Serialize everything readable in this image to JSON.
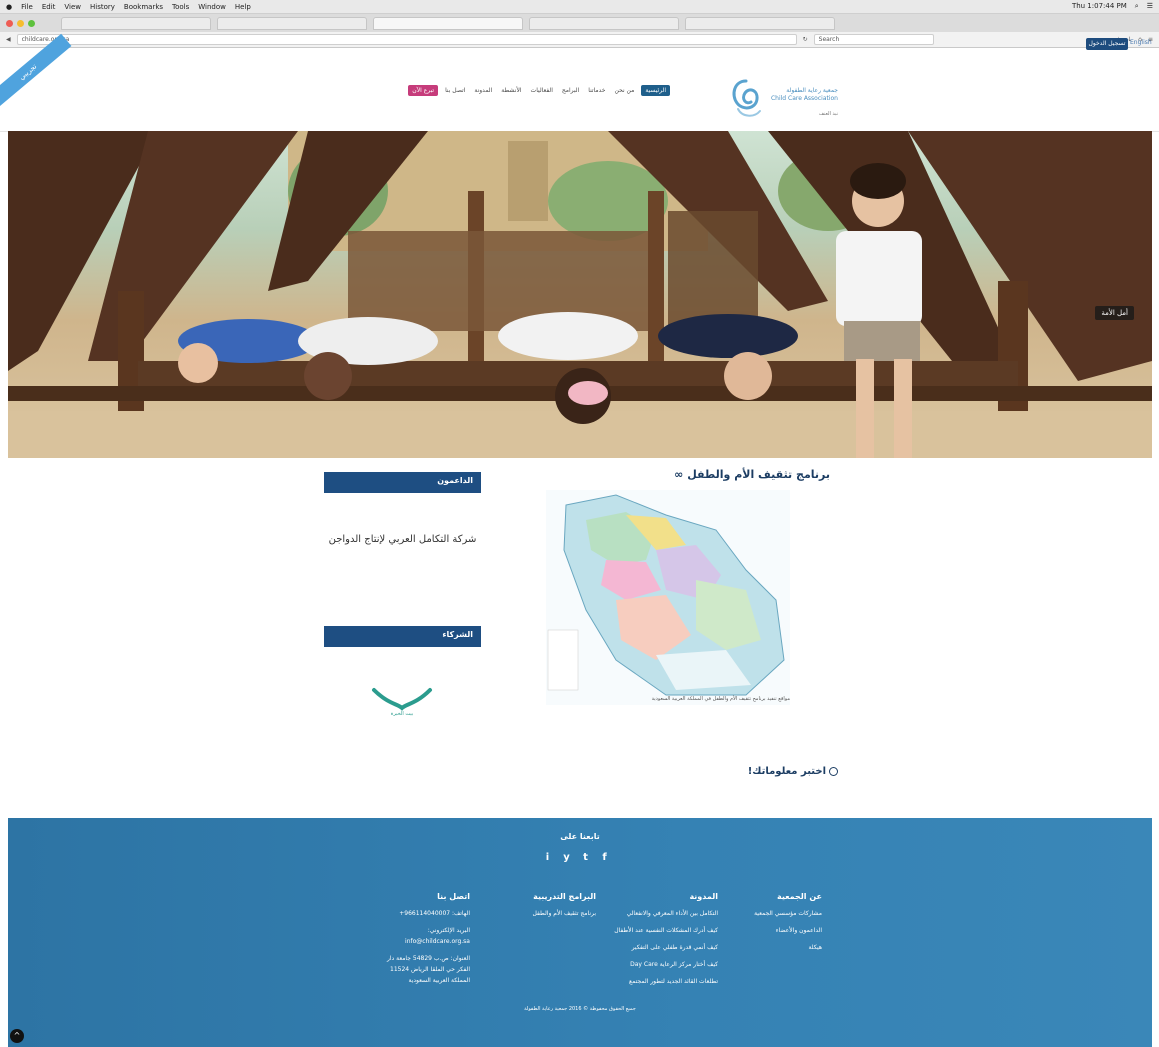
{
  "os_menu": {
    "items": [
      "File",
      "Edit",
      "View",
      "History",
      "Bookmarks",
      "Tools",
      "Window",
      "Help"
    ],
    "clock": "Thu 1:07:44 PM"
  },
  "browser": {
    "url": "childcare.org.sa",
    "search_placeholder": "Search"
  },
  "header": {
    "ribbon": "تجريبي",
    "login": "تسجيل الدخول",
    "lang": "English",
    "logo_name": "جمعية رعاية الطفولة",
    "logo_en": "Child Care Association",
    "logo_sub": "نبذ العنف",
    "nav": [
      "الرئيسية",
      "من نحن",
      "خدماتنا",
      "البرامج",
      "الفعاليات",
      "الأنشطة",
      "المدونة",
      "اتصل بنا",
      "تبرع الآن"
    ]
  },
  "hero": {
    "caption": "أمل الأمة"
  },
  "main": {
    "title": "برنامج تثقيف الأم والطفل",
    "map_caption": "مواقع تنفيذ برنامج تثقيف الأم والطفل في المملكة العربية السعودية",
    "quiz": "اختبر معلوماتك!"
  },
  "sidebar": {
    "supporters_title": "الداعمون",
    "supporter": "شركة التكامل العربي لإنتاج الدواجن",
    "partners_title": "الشركاء",
    "partner_name": "بيت الخبرة"
  },
  "footer": {
    "follow": "تابعنا على",
    "socials": [
      "f",
      "t",
      "y",
      "i"
    ],
    "col1": {
      "title": "عن الجمعية",
      "links": [
        "مشاركات مؤسسي الجمعية",
        "الداعمون والأعضاء",
        "هيكلة"
      ]
    },
    "col2": {
      "title": "المدونة",
      "links": [
        "التكامل بين الأداء المعرفي والانفعالي",
        "كيف أدرك المشكلات النفسية عند الأطفال",
        "كيف أنمي قدرة طفلي على التفكير",
        "كيف أختار مركز الرعاية Day Care",
        "تطلعات القائد الجديد لتطور المجتمع"
      ]
    },
    "col3": {
      "title": "البرامج التدريبية",
      "links": [
        "برنامج تثقيف الأم والطفل"
      ]
    },
    "col4": {
      "title": "اتصل بنا",
      "links": [
        "الهاتف: 966114040007+",
        "البريد الإلكتروني:",
        "info@childcare.org.sa",
        "العنوان: ص.ب 54829 جامعة دار",
        "الفكر حي الملقا الرياض 11524",
        "المملكة العربية السعودية"
      ]
    },
    "copyright": "جميع الحقوق محفوظة © 2016 جمعية رعاية الطفولة"
  }
}
